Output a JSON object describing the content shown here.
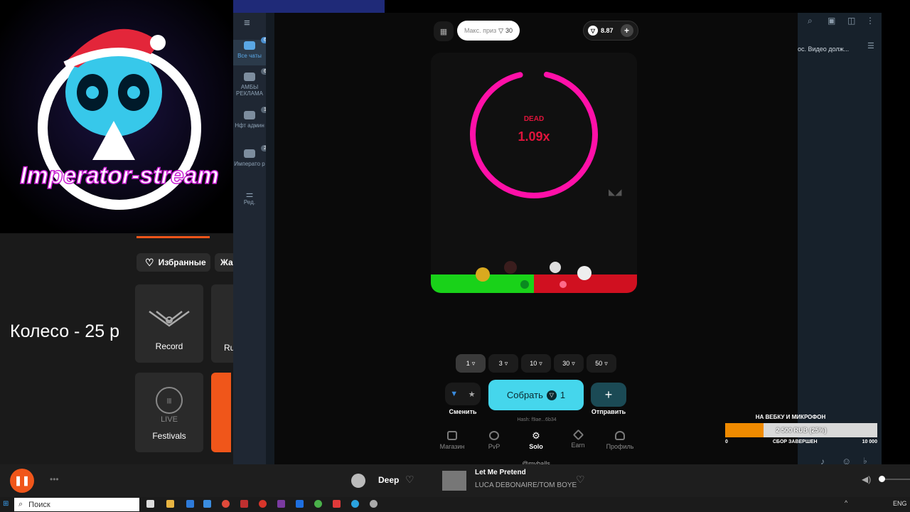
{
  "stream_overlay": {
    "logo_text": "Imperator-stream",
    "wheel_text": "Колесо - 25 р"
  },
  "radio": {
    "favorites_label": "Избранные",
    "second_filter_label": "Жа",
    "tiles": [
      {
        "label": "Record"
      },
      {
        "label": "Ru"
      },
      {
        "label": "Festivals"
      }
    ],
    "now_playing": {
      "station": "Deep",
      "track": "Let Me Pretend",
      "artist": "LUCA DEBONAIRE/TOM BOYE"
    }
  },
  "telegram": {
    "folders": [
      {
        "label": "Все чаты",
        "badge": "663"
      },
      {
        "label": "АМБЫ РЕКЛАМА",
        "badge": "6"
      },
      {
        "label": "Нфт админ",
        "badge": "12"
      },
      {
        "label": "Императо р",
        "badge": "2"
      },
      {
        "label": "Ред.",
        "badge": ""
      }
    ],
    "pinned_preview": "ос. Видео долж..."
  },
  "mini_app": {
    "max_prize_label": "Макс. приз",
    "max_prize_value": "30",
    "balance": "8.87",
    "game": {
      "status": "DEAD",
      "multiplier": "1.09x",
      "ring_progress": 0.93
    },
    "bets": [
      "1",
      "3",
      "10",
      "30",
      "50"
    ],
    "selected_bet_index": 0,
    "switch_label": "Сменить",
    "collect_label": "Собрать",
    "collect_value": "1",
    "send_label": "Отправить",
    "hash_label": "Hash: f9ae...6b34",
    "nav": [
      "Магазин",
      "PvP",
      "Solo",
      "Earn",
      "Профиль"
    ],
    "active_nav": "Solo",
    "username": "@myballs"
  },
  "donation": {
    "title": "НА ВЕБКУ И МИКРОФОН",
    "amount_label": "2 500 RUB (25%)",
    "progress": 0.25,
    "min": "0",
    "status": "СБОР ЗАВЕРШЕН",
    "max": "10 000"
  },
  "taskbar": {
    "search_placeholder": "Поиск",
    "lang": "ENG"
  },
  "colors": {
    "accent_cyan": "#45d6ec",
    "ring_pink": "#ff10a8",
    "dead_red": "#e0143c",
    "green_bar": "#19d219",
    "red_bar": "#d01020",
    "donation_orange": "#f08a00"
  }
}
